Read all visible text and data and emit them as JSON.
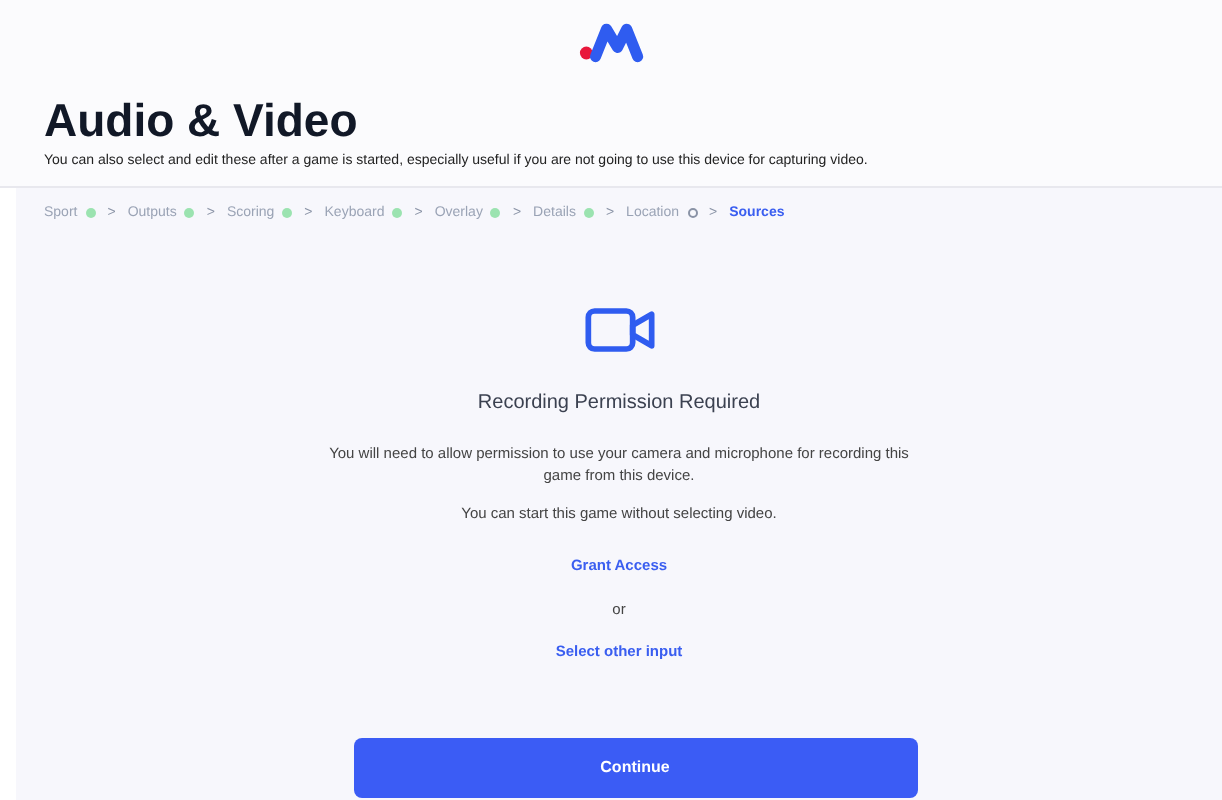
{
  "header": {
    "title": "Audio & Video",
    "subtitle": "You can also select and edit these after a game is started, especially useful if you are not going to use this device for capturing video."
  },
  "steps": [
    {
      "label": "Sport",
      "done": true,
      "selected": false
    },
    {
      "label": "Outputs",
      "done": true,
      "selected": false
    },
    {
      "label": "Scoring",
      "done": true,
      "selected": false
    },
    {
      "label": "Keyboard",
      "done": true,
      "selected": false
    },
    {
      "label": "Overlay",
      "done": true,
      "selected": false
    },
    {
      "label": "Details",
      "done": true,
      "selected": false
    },
    {
      "label": "Location",
      "done": false,
      "selected": false
    },
    {
      "label": "Sources",
      "selected": true
    }
  ],
  "separator": ">",
  "permission": {
    "heading": "Recording Permission Required",
    "message": "You will need to allow permission to use your camera and microphone for recording this game from this device.",
    "note": "You can start this game without selecting video.",
    "grant_link": "Grant Access",
    "or": "or",
    "other_link": "Select other input"
  },
  "continue_button": "Continue"
}
